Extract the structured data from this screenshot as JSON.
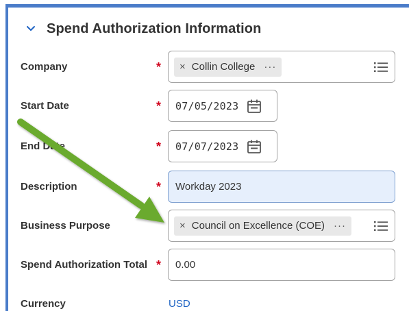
{
  "section": {
    "title": "Spend Authorization Information",
    "chevron_icon": "chevron-down-icon"
  },
  "fields": {
    "company": {
      "label": "Company",
      "required": "*",
      "value": "Collin College",
      "remove_glyph": "×",
      "more_glyph": "···"
    },
    "start_date": {
      "label": "Start Date",
      "required": "*",
      "value": "07/05/2023"
    },
    "end_date": {
      "label": "End Date",
      "required": "*",
      "value": "07/07/2023"
    },
    "description": {
      "label": "Description",
      "required": "*",
      "value": "Workday 2023"
    },
    "business_purpose": {
      "label": "Business Purpose",
      "value": "Council on Excellence (COE)",
      "remove_glyph": "×",
      "more_glyph": "···"
    },
    "spend_total": {
      "label": "Spend Authorization Total",
      "required": "*",
      "value": "0.00"
    },
    "currency": {
      "label": "Currency",
      "value": "USD"
    }
  },
  "colors": {
    "accent_border": "#4a7cc9",
    "required": "#d0021b",
    "link": "#1f64c4",
    "highlight_bg": "#e6effc",
    "annotation_arrow": "#6aaa2e"
  },
  "icons": {
    "list": "prompt-list-icon",
    "calendar": "calendar-icon",
    "annotation": "green-arrow-annotation"
  }
}
